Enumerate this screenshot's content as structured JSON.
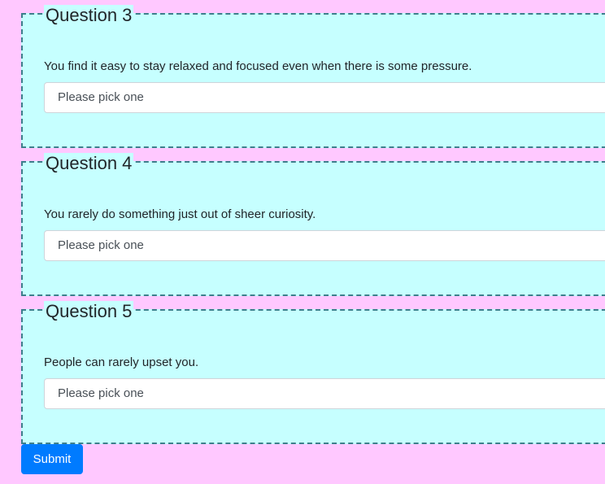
{
  "questions": [
    {
      "title": "Question 3",
      "text": "You find it easy to stay relaxed and focused even when there is some pressure.",
      "select_value": "Please pick one"
    },
    {
      "title": "Question 4",
      "text": "You rarely do something just out of sheer curiosity.",
      "select_value": "Please pick one"
    },
    {
      "title": "Question 5",
      "text": "People can rarely upset you.",
      "select_value": "Please pick one"
    }
  ],
  "submit_label": "Submit",
  "colors": {
    "page_background": "#ffc8ff",
    "panel_background": "#c6ffff",
    "dashed_border": "#3d7f8c",
    "button_background": "#007bff"
  }
}
